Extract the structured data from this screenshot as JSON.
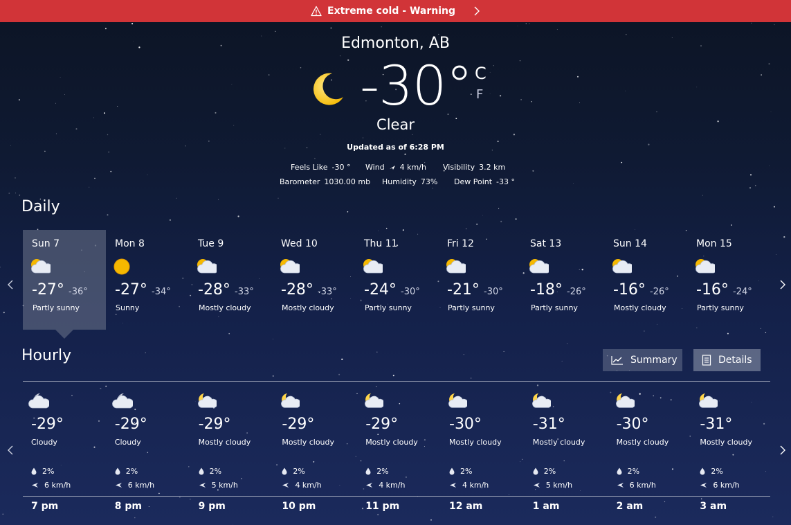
{
  "warning": {
    "text": "Extreme cold - Warning"
  },
  "current": {
    "city": "Edmonton, AB",
    "temperature": "-30°",
    "unit_c": "C",
    "unit_f": "F",
    "condition": "Clear",
    "updated": "Updated as of 6:28 PM",
    "stats": {
      "feels_like_label": "Feels Like",
      "feels_like": "-30 °",
      "wind_label": "Wind",
      "wind": "4 km/h",
      "visibility_label": "Visibility",
      "visibility": "3.2 km",
      "barometer_label": "Barometer",
      "barometer": "1030.00 mb",
      "humidity_label": "Humidity",
      "humidity": "73%",
      "dew_point_label": "Dew Point",
      "dew_point": "-33 °"
    }
  },
  "daily": {
    "heading": "Daily",
    "days": [
      {
        "date": "Sun 7",
        "icon": "partly-sunny-icon",
        "high": "-27°",
        "low": "-36°",
        "desc": "Partly sunny"
      },
      {
        "date": "Mon 8",
        "icon": "sun-icon",
        "high": "-27°",
        "low": "-34°",
        "desc": "Sunny"
      },
      {
        "date": "Tue 9",
        "icon": "partly-sunny-icon",
        "high": "-28°",
        "low": "-33°",
        "desc": "Mostly cloudy"
      },
      {
        "date": "Wed 10",
        "icon": "partly-sunny-icon",
        "high": "-28°",
        "low": "-33°",
        "desc": "Mostly cloudy"
      },
      {
        "date": "Thu 11",
        "icon": "partly-sunny-icon",
        "high": "-24°",
        "low": "-30°",
        "desc": "Partly sunny"
      },
      {
        "date": "Fri 12",
        "icon": "partly-sunny-icon",
        "high": "-21°",
        "low": "-30°",
        "desc": "Partly sunny"
      },
      {
        "date": "Sat 13",
        "icon": "partly-sunny-icon",
        "high": "-18°",
        "low": "-26°",
        "desc": "Partly sunny"
      },
      {
        "date": "Sun 14",
        "icon": "partly-sunny-icon",
        "high": "-16°",
        "low": "-26°",
        "desc": "Mostly cloudy"
      },
      {
        "date": "Mon 15",
        "icon": "partly-sunny-icon",
        "high": "-16°",
        "low": "-24°",
        "desc": "Partly sunny"
      }
    ]
  },
  "hourly": {
    "heading": "Hourly",
    "summary_label": "Summary",
    "details_label": "Details",
    "hours": [
      {
        "icon": "cloudy-night-icon",
        "temp": "-29°",
        "desc": "Cloudy",
        "precip": "2%",
        "wind": "6 km/h",
        "time": "7 pm"
      },
      {
        "icon": "cloudy-night-icon",
        "temp": "-29°",
        "desc": "Cloudy",
        "precip": "2%",
        "wind": "6 km/h",
        "time": "8 pm"
      },
      {
        "icon": "mostly-cloudy-night-icon",
        "temp": "-29°",
        "desc": "Mostly cloudy",
        "precip": "2%",
        "wind": "5 km/h",
        "time": "9 pm"
      },
      {
        "icon": "mostly-cloudy-night-icon",
        "temp": "-29°",
        "desc": "Mostly cloudy",
        "precip": "2%",
        "wind": "4 km/h",
        "time": "10 pm"
      },
      {
        "icon": "mostly-cloudy-night-icon",
        "temp": "-29°",
        "desc": "Mostly cloudy",
        "precip": "2%",
        "wind": "4 km/h",
        "time": "11 pm"
      },
      {
        "icon": "mostly-cloudy-night-icon",
        "temp": "-30°",
        "desc": "Mostly cloudy",
        "precip": "2%",
        "wind": "4 km/h",
        "time": "12 am"
      },
      {
        "icon": "mostly-cloudy-night-icon",
        "temp": "-31°",
        "desc": "Mostly cloudy",
        "precip": "2%",
        "wind": "5 km/h",
        "time": "1 am"
      },
      {
        "icon": "mostly-cloudy-night-icon",
        "temp": "-30°",
        "desc": "Mostly cloudy",
        "precip": "2%",
        "wind": "6 km/h",
        "time": "2 am"
      },
      {
        "icon": "mostly-cloudy-night-icon",
        "temp": "-31°",
        "desc": "Mostly cloudy",
        "precip": "2%",
        "wind": "6 km/h",
        "time": "3 am"
      }
    ]
  },
  "colors": {
    "warning_bg": "#d13438",
    "moon": "#ffd54a",
    "sun": "#f5b800",
    "cloud": "#e8ecf4"
  }
}
